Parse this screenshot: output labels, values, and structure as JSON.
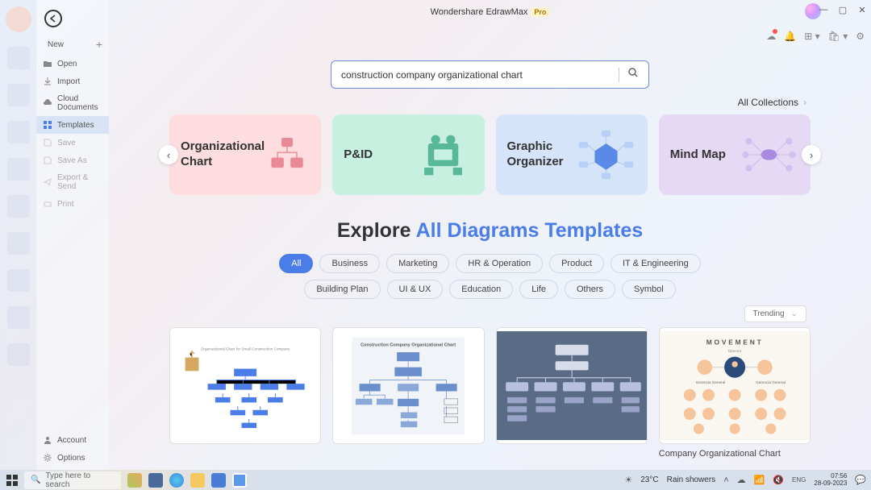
{
  "app": {
    "title": "Wondershare EdrawMax",
    "badge": "Pro"
  },
  "sidebar": {
    "new": "New",
    "items": [
      {
        "label": "Open"
      },
      {
        "label": "Import"
      },
      {
        "label": "Cloud Documents"
      },
      {
        "label": "Templates"
      },
      {
        "label": "Save"
      },
      {
        "label": "Save As"
      },
      {
        "label": "Export & Send"
      },
      {
        "label": "Print"
      }
    ],
    "account": "Account",
    "options": "Options"
  },
  "search": {
    "value": "construction company organizational chart"
  },
  "all_collections": "All Collections",
  "categories": [
    {
      "label": "Organizational\nChart"
    },
    {
      "label": "P&ID"
    },
    {
      "label": "Graphic\nOrganizer"
    },
    {
      "label": "Mind Map"
    }
  ],
  "explore": {
    "part1": "Explore ",
    "part2": "All Diagrams Templates"
  },
  "filters": {
    "row1": [
      "All",
      "Business",
      "Marketing",
      "HR & Operation",
      "Product",
      "IT & Engineering",
      "Building Plan"
    ],
    "row2": [
      "UI & UX",
      "Education",
      "Life",
      "Others",
      "Symbol"
    ]
  },
  "sort": {
    "selected": "Trending"
  },
  "templates": [
    {
      "title": "Organizational Chart for Small Construction Company"
    },
    {
      "title": "Construction Company Organizational Chart"
    },
    {
      "title": ""
    },
    {
      "title": "Company Organizational Chart"
    }
  ],
  "taskbar": {
    "search_placeholder": "Type here to search",
    "weather_temp": "23°C",
    "weather_desc": "Rain showers",
    "time": "07:56",
    "date": "28-09-2023"
  }
}
